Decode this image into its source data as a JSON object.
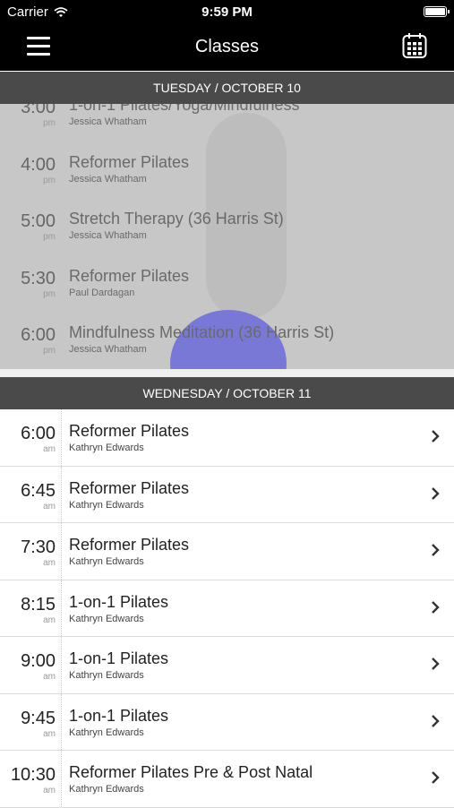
{
  "status": {
    "carrier": "Carrier",
    "time": "9:59 PM"
  },
  "nav": {
    "title": "Classes"
  },
  "days": [
    {
      "label": "TUESDAY / OCTOBER 10",
      "classes": [
        {
          "time": "3:00",
          "ampm": "pm",
          "title": "1-on-1 Pilates/Yoga/Mindfulness",
          "instructor": "Jessica Whatham"
        },
        {
          "time": "4:00",
          "ampm": "pm",
          "title": "Reformer Pilates",
          "instructor": "Jessica Whatham"
        },
        {
          "time": "5:00",
          "ampm": "pm",
          "title": "Stretch Therapy (36 Harris St)",
          "instructor": "Jessica Whatham"
        },
        {
          "time": "5:30",
          "ampm": "pm",
          "title": "Reformer Pilates",
          "instructor": "Paul Dardagan"
        },
        {
          "time": "6:00",
          "ampm": "pm",
          "title": "Mindfulness Meditation (36 Harris St)",
          "instructor": "Jessica Whatham"
        }
      ]
    },
    {
      "label": "WEDNESDAY / OCTOBER 11",
      "classes": [
        {
          "time": "6:00",
          "ampm": "am",
          "title": "Reformer Pilates",
          "instructor": "Kathryn Edwards"
        },
        {
          "time": "6:45",
          "ampm": "am",
          "title": "Reformer Pilates",
          "instructor": "Kathryn Edwards"
        },
        {
          "time": "7:30",
          "ampm": "am",
          "title": "Reformer Pilates",
          "instructor": "Kathryn Edwards"
        },
        {
          "time": "8:15",
          "ampm": "am",
          "title": "1-on-1 Pilates",
          "instructor": "Kathryn Edwards"
        },
        {
          "time": "9:00",
          "ampm": "am",
          "title": "1-on-1 Pilates",
          "instructor": "Kathryn Edwards"
        },
        {
          "time": "9:45",
          "ampm": "am",
          "title": "1-on-1 Pilates",
          "instructor": "Kathryn Edwards"
        },
        {
          "time": "10:30",
          "ampm": "am",
          "title": "Reformer Pilates Pre & Post Natal",
          "instructor": "Kathryn Edwards"
        }
      ]
    }
  ],
  "icons": {
    "menu": "hamburger-menu-icon",
    "calendar": "calendar-icon",
    "chevron": "chevron-right-icon",
    "wifi": "wifi-icon",
    "battery": "battery-icon"
  },
  "battery_level": 1.0
}
